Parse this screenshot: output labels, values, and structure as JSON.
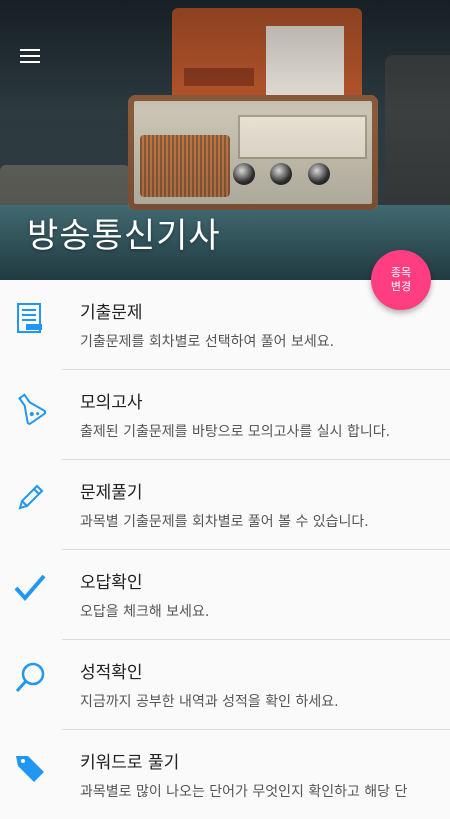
{
  "header": {
    "title": "방송통신기사",
    "change_button": "종목 변경"
  },
  "menu_items": [
    {
      "title": "기출문제",
      "desc": "기출문제를 회차별로 선택하여 풀어 보세요.",
      "icon": "list-document-icon"
    },
    {
      "title": "모의고사",
      "desc": "출제된 기출문제를 바탕으로 모의고사를 실시 합니다.",
      "icon": "flask-icon"
    },
    {
      "title": "문제풀기",
      "desc": "과목별 기출문제를 회차별로 풀어 볼 수 있습니다.",
      "icon": "pencil-icon"
    },
    {
      "title": "오답확인",
      "desc": "오답을 체크해 보세요.",
      "icon": "checkmark-icon"
    },
    {
      "title": "성적확인",
      "desc": "지금까지 공부한 내역과 성적을 확인 하세요.",
      "icon": "magnifier-icon"
    },
    {
      "title": "키워드로 풀기",
      "desc": "과목별로 많이 나오는 단어가 무엇인지 확인하고 해당 단",
      "icon": "tag-icon"
    }
  ],
  "colors": {
    "accent": "#2196f3",
    "fab": "#ff3e82"
  }
}
